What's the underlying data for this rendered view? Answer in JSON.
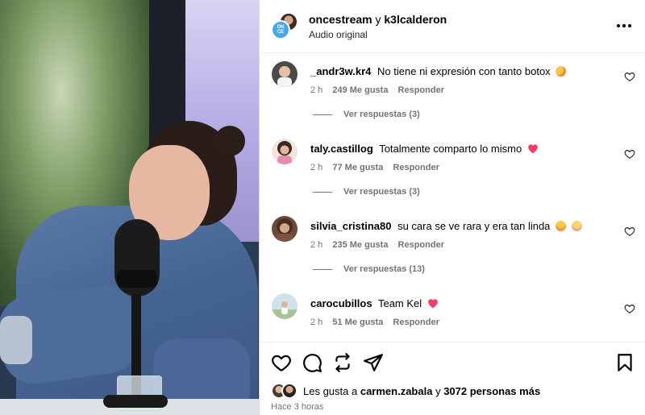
{
  "post": {
    "author_primary": "oncestream",
    "author_conjunction": "y",
    "author_secondary": "k3lcalderon",
    "audio_label": "Audio original",
    "logo_text": "ON CE"
  },
  "comments": [
    {
      "username": "_andr3w.kr4",
      "text": "No tiene ni expresión con tanto botox",
      "emoji": [
        "laughing-sweat-emoji"
      ],
      "time": "2 h",
      "likes": "249 Me gusta",
      "reply": "Responder",
      "view_replies": "Ver respuestas (3)"
    },
    {
      "username": "taly.castillog",
      "text": "Totalmente comparto lo mismo",
      "emoji": [
        "heart-emoji"
      ],
      "time": "2 h",
      "likes": "77 Me gusta",
      "reply": "Responder",
      "view_replies": "Ver respuestas (3)"
    },
    {
      "username": "silvia_cristina80",
      "text": "su cara se ve rara y era tan linda",
      "emoji": [
        "hand-over-mouth-emoji",
        "pleading-face-emoji"
      ],
      "time": "2 h",
      "likes": "235 Me gusta",
      "reply": "Responder",
      "view_replies": "Ver respuestas (13)"
    },
    {
      "username": "carocubillos",
      "text": "Team Kel",
      "emoji": [
        "heart-emoji"
      ],
      "time": "2 h",
      "likes": "51 Me gusta",
      "reply": "Responder"
    }
  ],
  "footer": {
    "likes_prefix": "Les gusta a",
    "liked_by": "carmen.zabala",
    "likes_conj": "y",
    "likes_others": "3072 personas más",
    "posted_ago": "Hace 3 horas"
  },
  "icons": [
    "heart-icon",
    "comment-icon",
    "repost-icon",
    "share-icon",
    "bookmark-icon",
    "more-options-icon"
  ],
  "colors": {
    "text_primary": "#000000",
    "text_secondary": "#737373",
    "heart_emoji": "#ef3e6a",
    "logo_blue": "#47a7e6",
    "divider": "#efefef"
  }
}
